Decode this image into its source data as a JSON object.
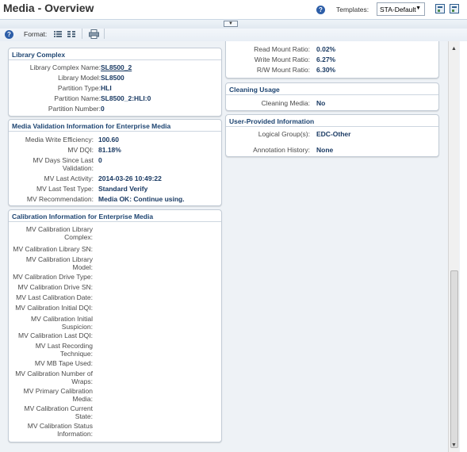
{
  "header": {
    "title": "Media - Overview",
    "templates_label": "Templates:",
    "template_selected": "STA-Default"
  },
  "toolbar": {
    "format_label": "Format:"
  },
  "library_complex": {
    "title": "Library Complex",
    "fields": [
      {
        "label": "Library Complex Name:",
        "value": "SL8500_2"
      },
      {
        "label": "Library Model:",
        "value": "SL8500"
      },
      {
        "label": "Partition Type:",
        "value": "HLI"
      },
      {
        "label": "Partition Name:",
        "value": "SL8500_2:HLI:0"
      },
      {
        "label": "Partition Number:",
        "value": "0"
      }
    ]
  },
  "media_validation": {
    "title": "Media Validation Information for Enterprise Media",
    "fields": [
      {
        "label": "Media Write Efficiency:",
        "value": "100.60"
      },
      {
        "label": "MV DQI:",
        "value": "81.18%"
      },
      {
        "label": "MV Days Since Last Validation:",
        "value": "0"
      },
      {
        "label": "MV Last Activity:",
        "value": "2014-03-26 10:49:22"
      },
      {
        "label": "MV Last Test Type:",
        "value": "Standard Verify"
      },
      {
        "label": "MV Recommendation:",
        "value": "Media OK: Continue using."
      }
    ]
  },
  "calibration": {
    "title": "Calibration Information for Enterprise Media",
    "fields": [
      {
        "label": "MV Calibration Library Complex:",
        "value": ""
      },
      {
        "label": "MV Calibration Library SN:",
        "value": ""
      },
      {
        "label": "MV Calibration Library Model:",
        "value": ""
      },
      {
        "label": "MV Calibration Drive Type:",
        "value": ""
      },
      {
        "label": "MV Calibration Drive SN:",
        "value": ""
      },
      {
        "label": "MV Last Calibration Date:",
        "value": ""
      },
      {
        "label": "MV Calibration Initial DQI:",
        "value": ""
      },
      {
        "label": "MV Calibration Initial Suspicion:",
        "value": ""
      },
      {
        "label": "MV Calibration Last DQI:",
        "value": ""
      },
      {
        "label": "MV Last Recording Technique:",
        "value": ""
      },
      {
        "label": "MV MB Tape Used:",
        "value": ""
      },
      {
        "label": "MV Calibration Number of Wraps:",
        "value": ""
      },
      {
        "label": "MV Primary Calibration Media:",
        "value": ""
      },
      {
        "label": "MV Calibration Current State:",
        "value": ""
      },
      {
        "label": "MV Calibration Status Information:",
        "value": ""
      }
    ]
  },
  "mount_ratios": {
    "fields": [
      {
        "label": "Read Mount Ratio:",
        "value": "0.02%"
      },
      {
        "label": "Write Mount Ratio:",
        "value": "6.27%"
      },
      {
        "label": "R/W Mount Ratio:",
        "value": "6.30%"
      }
    ]
  },
  "cleaning_usage": {
    "title": "Cleaning Usage",
    "fields": [
      {
        "label": "Cleaning Media:",
        "value": "No"
      }
    ]
  },
  "user_provided": {
    "title": "User-Provided Information",
    "fields": [
      {
        "label": "Logical Group(s):",
        "value": "EDC-Other"
      },
      {
        "label": "Annotation History:",
        "value": "None"
      }
    ]
  },
  "colors": {
    "header_text": "#1d4471",
    "value_text": "#1a3a63",
    "panel_border": "#c3ccd6",
    "content_bg": "#eef2f6"
  }
}
